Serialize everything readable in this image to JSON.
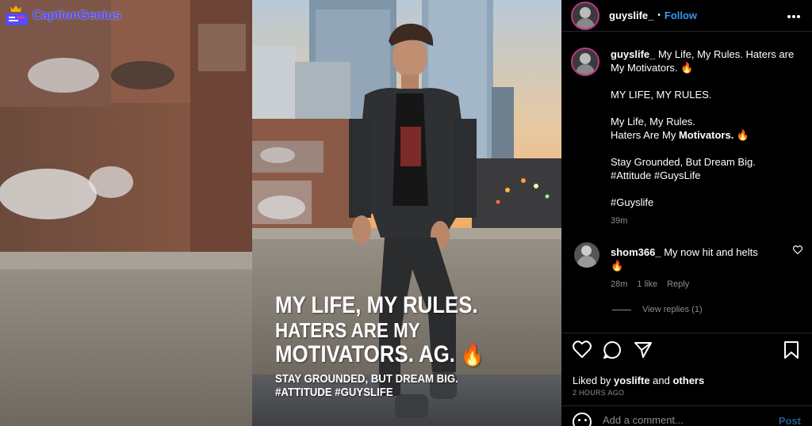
{
  "brand": {
    "name": "CaptionGenius",
    "color": "#4b4bff"
  },
  "photo": {
    "overlay": {
      "line1": "MY LIFE, MY RULES.",
      "line2": "HATERS ARE MY",
      "line3": "MOTIVATORS. AG.",
      "fire": "🔥",
      "line4": "STAY GROUNDED, BUT DREAM BIG.",
      "line5": "#ATTITUDE #GUYSLIFE"
    }
  },
  "header": {
    "username": "guyslife_",
    "dot": "•",
    "follow_label": "Follow",
    "more_icon": "more-horizontal-icon"
  },
  "caption": {
    "username": "guyslife_",
    "first_text": " My Life, My Rules. Haters are My Motivators. ",
    "fire": "🔥",
    "line1": "MY LIFE, MY RULES.",
    "line2a": "My Life, My Rules.",
    "line2b_pre": "Haters Are My ",
    "line2b_bold": "Motivators.",
    "line2b_fire": " 🔥",
    "line3a": "Stay Grounded, But Dream Big.",
    "line3b": "#Attitude #GuysLife",
    "line4": "#Guyslife",
    "time": "39m"
  },
  "comment": {
    "username": "shom366_",
    "text": " My now hit and helts",
    "fire": "🔥",
    "time": "28m",
    "likes": "1 like",
    "reply_label": "Reply",
    "view_replies": "View replies (1)"
  },
  "actions": {
    "like_icon": "heart-icon",
    "comment_icon": "comment-icon",
    "share_icon": "share-icon",
    "save_icon": "bookmark-icon"
  },
  "likes": {
    "prefix": "Liked by ",
    "user": "yoslifte",
    "middle": " and ",
    "others": "others"
  },
  "post_date": "2 HOURS AGO",
  "add_comment": {
    "placeholder": "Add a comment...",
    "post_label": "Post"
  },
  "colors": {
    "link_blue": "#3897f0",
    "muted": "#8e8e8e",
    "story_ring": "#c13584"
  }
}
